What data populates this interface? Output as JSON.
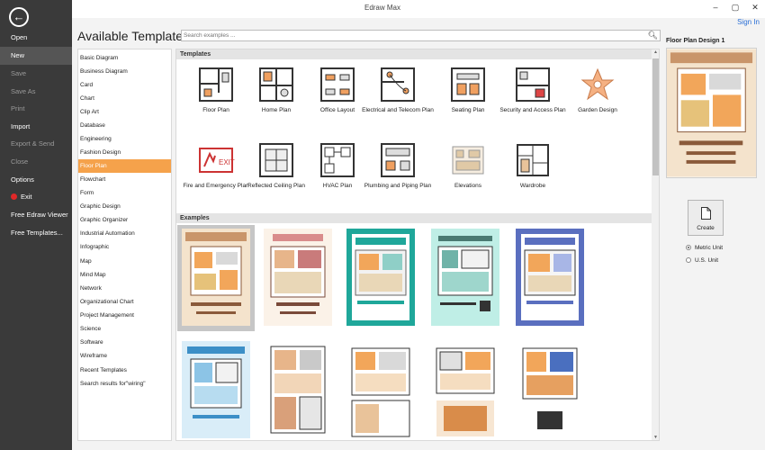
{
  "window": {
    "title": "Edraw Max",
    "minimize": "–",
    "restore": "▢",
    "close": "✕",
    "sign_in": "Sign In"
  },
  "sidebar": {
    "back_glyph": "←",
    "items": [
      {
        "label": "Open",
        "state": "normal"
      },
      {
        "label": "New",
        "state": "active"
      },
      {
        "label": "Save",
        "state": "disabled"
      },
      {
        "label": "Save As",
        "state": "disabled"
      },
      {
        "label": "Print",
        "state": "disabled"
      },
      {
        "label": "Import",
        "state": "normal"
      },
      {
        "label": "Export & Send",
        "state": "disabled"
      },
      {
        "label": "Close",
        "state": "disabled"
      },
      {
        "label": "Options",
        "state": "normal"
      },
      {
        "label": "Exit",
        "state": "normal"
      },
      {
        "label": "Free Edraw Viewer",
        "state": "normal"
      },
      {
        "label": "Free Templates...",
        "state": "normal"
      }
    ]
  },
  "heading": "Available Templates",
  "search": {
    "placeholder": "Search examples ...",
    "icon": "search-icon"
  },
  "categories": [
    "Basic Diagram",
    "Business Diagram",
    "Card",
    "Chart",
    "Clip Art",
    "Database",
    "Engineering",
    "Fashion Design",
    "Floor Plan",
    "Flowchart",
    "Form",
    "Graphic Design",
    "Graphic Organizer",
    "Industrial Automation",
    "Infographic",
    "Map",
    "Mind Map",
    "Network",
    "Organizational Chart",
    "Project Management",
    "Science",
    "Software",
    "Wireframe",
    "Recent Templates",
    "Search results for\"wiring\""
  ],
  "selected_category": "Floor Plan",
  "templates_heading": "Templates",
  "templates": [
    "Floor Plan",
    "Home Plan",
    "Office Layout",
    "Electrical and Telecom Plan",
    "Seating Plan",
    "Security and Access Plan",
    "Garden Design",
    "Fire and Emergency Plan",
    "Reflected Ceiling Plan",
    "HVAC Plan",
    "Plumbing and Piping Plan",
    "Elevations",
    "Wardrobe"
  ],
  "examples_heading": "Examples",
  "preview": {
    "title": "Floor Plan Design 1"
  },
  "create_label": "Create",
  "units": [
    {
      "label": "Metric Unit",
      "selected": true
    },
    {
      "label": "U.S. Unit",
      "selected": false
    }
  ],
  "colors": {
    "sidebar": "#3a3a3a",
    "accent": "#f5a24b",
    "link": "#2a6fd6"
  }
}
